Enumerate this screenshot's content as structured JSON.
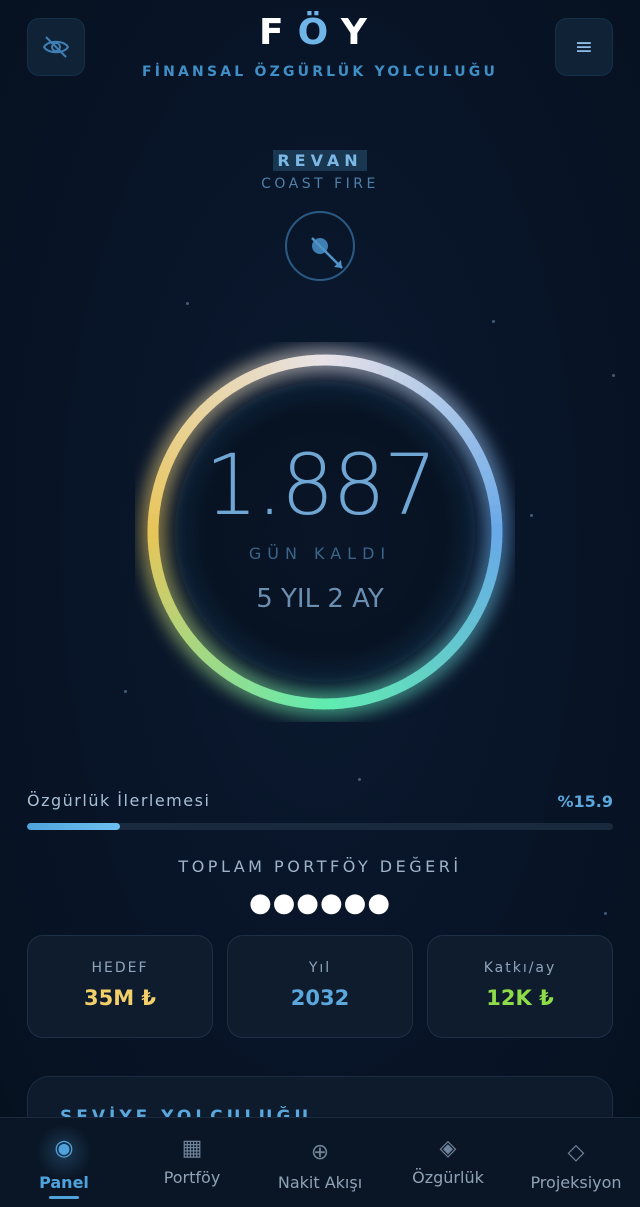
{
  "app": {
    "logo_left": "F",
    "logo_accent": "Ö",
    "logo_right": "Y",
    "tagline": "FİNANSAL ÖZGÜRLÜK YOLCULUĞU"
  },
  "header": {
    "hide_icon": "eye-off-icon",
    "menu_icon": "menu-icon",
    "menu_glyph": "≡"
  },
  "level": {
    "name": "REVAN",
    "subtitle": "COAST FIRE",
    "icon": "compass-icon"
  },
  "countdown": {
    "days": "1.887",
    "label": "GÜN KALDI",
    "duration": "5 YIL 2 AY"
  },
  "progress": {
    "label": "Özgürlük İlerlemesi",
    "value_text": "%15.9",
    "fraction": 0.159
  },
  "portfolio": {
    "label": "TOPLAM PORTFÖY DEĞERİ",
    "value_masked": "●●●●●●"
  },
  "stats": [
    {
      "label": "HEDEF",
      "value": "35M ₺"
    },
    {
      "label": "Yıl",
      "value": "2032"
    },
    {
      "label": "Katkı/ay",
      "value": "12K ₺"
    }
  ],
  "journey": {
    "title": "SEVİYE YOLCULUĞU"
  },
  "nav": [
    {
      "label": "Panel",
      "icon": "target-icon",
      "glyph": "◉",
      "active": true
    },
    {
      "label": "Portföy",
      "icon": "grid-icon",
      "glyph": "▦"
    },
    {
      "label": "Nakit Akışı",
      "icon": "plus-circle-icon",
      "glyph": "⊕"
    },
    {
      "label": "Özgürlük",
      "icon": "diamond-filled-icon",
      "glyph": "◈"
    },
    {
      "label": "Projeksiyon",
      "icon": "diamond-icon",
      "glyph": "◇"
    }
  ],
  "colors": {
    "accent": "#4fa3dc",
    "background": "#081427",
    "gold": "#f3cf6a",
    "green": "#8fdc4a"
  }
}
